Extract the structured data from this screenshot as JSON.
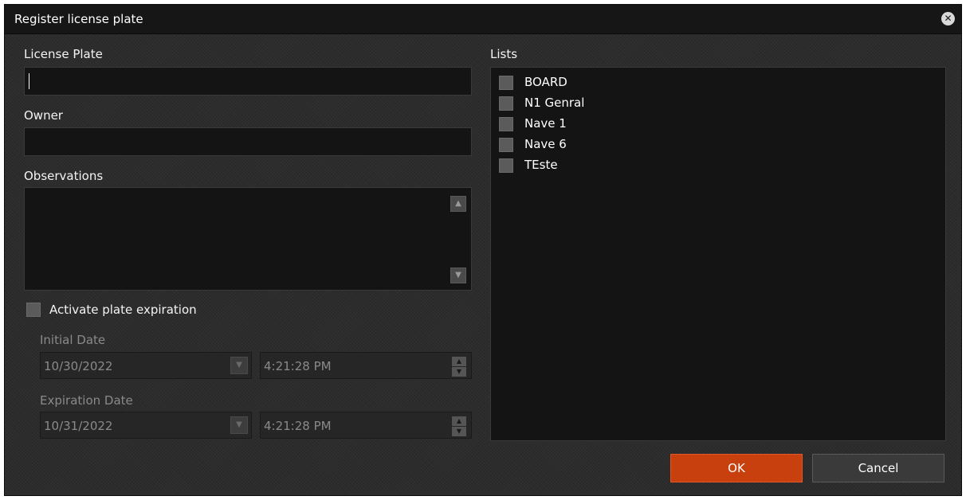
{
  "dialog": {
    "title": "Register license plate",
    "close_icon": "close-circle-icon"
  },
  "form": {
    "license_plate": {
      "label": "License Plate",
      "value": ""
    },
    "owner": {
      "label": "Owner",
      "value": ""
    },
    "observations": {
      "label": "Observations",
      "value": ""
    },
    "activate_expiration": {
      "label": "Activate plate expiration",
      "checked": false
    },
    "initial_date": {
      "label": "Initial Date",
      "date": "10/30/2022",
      "time": "4:21:28 PM"
    },
    "expiration_date": {
      "label": "Expiration Date",
      "date": "10/31/2022",
      "time": "4:21:28 PM"
    }
  },
  "lists": {
    "label": "Lists",
    "items": [
      {
        "label": "BOARD",
        "checked": false
      },
      {
        "label": "N1 Genral",
        "checked": false
      },
      {
        "label": "Nave 1",
        "checked": false
      },
      {
        "label": "Nave 6",
        "checked": false
      },
      {
        "label": "TEste",
        "checked": false
      }
    ]
  },
  "buttons": {
    "ok": "OK",
    "cancel": "Cancel"
  },
  "colors": {
    "accent": "#c8400e",
    "background": "#2c2c2c",
    "titlebar": "#161616"
  }
}
